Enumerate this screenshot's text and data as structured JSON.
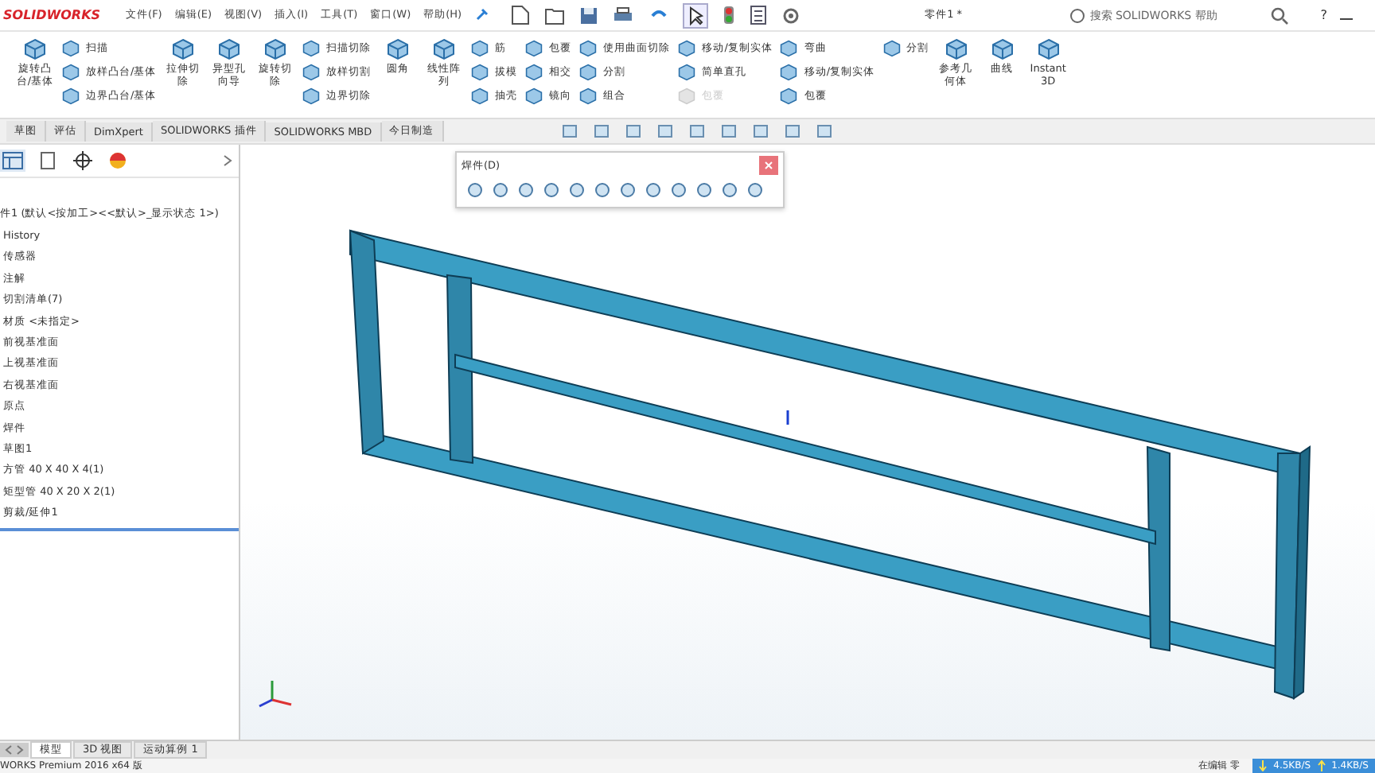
{
  "title_bar": {
    "logo": "SOLIDWORKS",
    "menus": [
      "文件(F)",
      "编辑(E)",
      "视图(V)",
      "插入(I)",
      "工具(T)",
      "窗口(W)",
      "帮助(H)"
    ],
    "document_title": "零件1 *",
    "search": {
      "placeholder": "搜索 SOLIDWORKS 帮助"
    },
    "help": "?"
  },
  "ribbon": [
    {
      "kind": "large",
      "label": "旋转凸台/基体"
    },
    {
      "kind": "stack",
      "items": [
        {
          "label": "扫描",
          "disabled": false
        },
        {
          "label": "放样凸台/基体",
          "disabled": false
        },
        {
          "label": "边界凸台/基体",
          "disabled": false
        }
      ]
    },
    {
      "kind": "large",
      "label": "拉伸切除"
    },
    {
      "kind": "large",
      "label": "异型孔向导"
    },
    {
      "kind": "large",
      "label": "旋转切除"
    },
    {
      "kind": "stack",
      "items": [
        {
          "label": "扫描切除",
          "disabled": false
        },
        {
          "label": "放样切割",
          "disabled": false
        },
        {
          "label": "边界切除",
          "disabled": false
        }
      ]
    },
    {
      "kind": "large",
      "label": "圆角"
    },
    {
      "kind": "large",
      "label": "线性阵列"
    },
    {
      "kind": "stack",
      "items": [
        {
          "label": "筋",
          "disabled": false
        },
        {
          "label": "拔模",
          "disabled": false
        },
        {
          "label": "抽壳",
          "disabled": false
        }
      ]
    },
    {
      "kind": "stack",
      "items": [
        {
          "label": "包覆",
          "disabled": false
        },
        {
          "label": "相交",
          "disabled": false
        },
        {
          "label": "镜向",
          "disabled": false
        }
      ]
    },
    {
      "kind": "stack",
      "items": [
        {
          "label": "使用曲面切除",
          "disabled": false
        },
        {
          "label": "分割",
          "disabled": false
        },
        {
          "label": "组合",
          "disabled": false
        }
      ]
    },
    {
      "kind": "stack",
      "items": [
        {
          "label": "移动/复制实体",
          "disabled": false
        },
        {
          "label": "简单直孔",
          "disabled": false
        },
        {
          "label": "包覆",
          "disabled": true
        }
      ]
    },
    {
      "kind": "stack",
      "items": [
        {
          "label": "弯曲",
          "disabled": false
        },
        {
          "label": "移动/复制实体",
          "disabled": false
        },
        {
          "label": "包覆",
          "disabled": false
        }
      ]
    },
    {
      "kind": "stack",
      "items": [
        {
          "label": "分割",
          "disabled": false
        }
      ]
    },
    {
      "kind": "large",
      "label": "参考几何体"
    },
    {
      "kind": "large",
      "label": "曲线"
    },
    {
      "kind": "large",
      "label": "Instant3D"
    }
  ],
  "command_tabs": [
    "草图",
    "评估",
    "DimXpert",
    "SOLIDWORKS 插件",
    "SOLIDWORKS MBD",
    "今日制造"
  ],
  "feature_tree": {
    "root": "件1 (默认<按加工><<默认>_显示状态 1>)",
    "items": [
      "History",
      "传感器",
      "注解",
      "切割清单(7)",
      "材质 <未指定>",
      "前视基准面",
      "上视基准面",
      "右视基准面",
      "原点",
      "焊件",
      "草图1",
      "方管 40 X 40 X 4(1)",
      "矩型管 40 X 20 X 2(1)",
      "剪裁/延伸1"
    ]
  },
  "weldment_toolbar": {
    "title": "焊件(D)"
  },
  "bottom_tabs": [
    {
      "label": "模型",
      "selected": true
    },
    {
      "label": "3D 视图",
      "selected": false
    },
    {
      "label": "运动算例 1",
      "selected": false
    }
  ],
  "status_bar": {
    "product": "WORKS Premium 2016 x64 版",
    "editing": "在编辑 零",
    "download": "4.5KB/S",
    "upload": "1.4KB/S"
  }
}
